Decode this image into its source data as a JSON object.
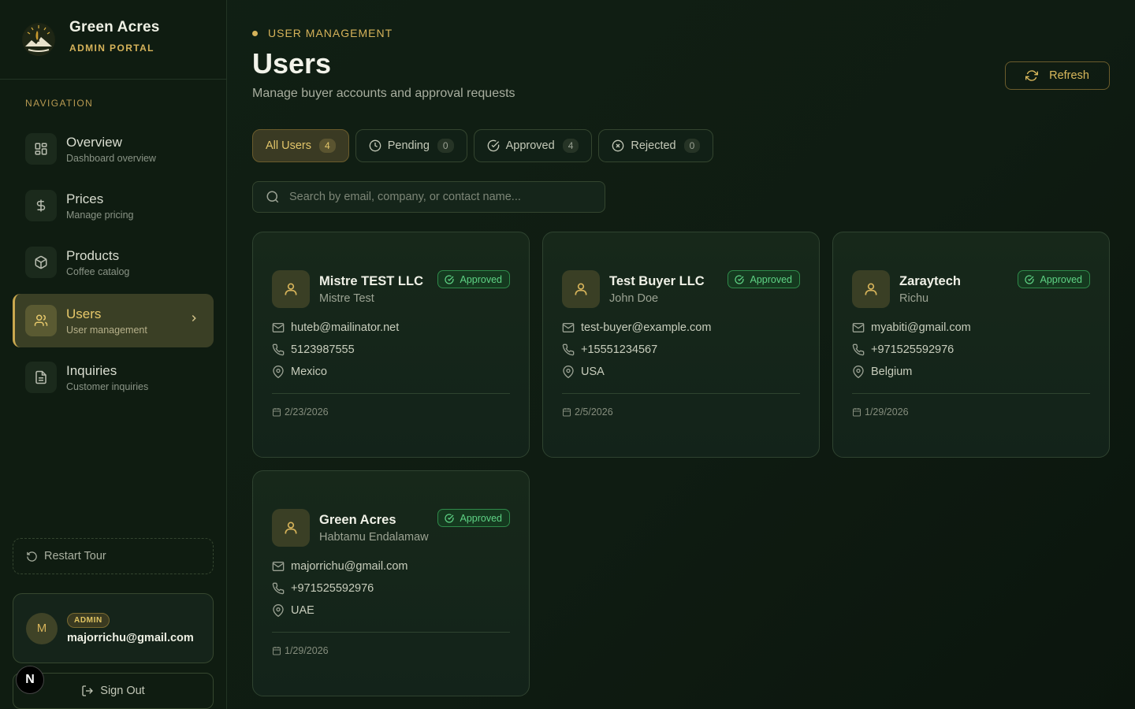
{
  "brand": {
    "title": "Green Acres",
    "subtitle": "ADMIN PORTAL"
  },
  "sidebar": {
    "heading": "NAVIGATION",
    "items": [
      {
        "label": "Overview",
        "desc": "Dashboard overview",
        "icon": "grid-icon"
      },
      {
        "label": "Prices",
        "desc": "Manage pricing",
        "icon": "dollar-icon"
      },
      {
        "label": "Products",
        "desc": "Coffee catalog",
        "icon": "box-icon"
      },
      {
        "label": "Users",
        "desc": "User management",
        "icon": "users-icon",
        "active": true
      },
      {
        "label": "Inquiries",
        "desc": "Customer inquiries",
        "icon": "file-icon"
      }
    ],
    "restart_label": "Restart Tour",
    "user": {
      "initial": "M",
      "role": "ADMIN",
      "email": "majorrichu@gmail.com"
    },
    "signout_label": "Sign Out",
    "n_badge": "N"
  },
  "header": {
    "eyebrow": "USER MANAGEMENT",
    "title": "Users",
    "subtitle": "Manage buyer accounts and approval requests",
    "refresh_label": "Refresh"
  },
  "tabs": [
    {
      "label": "All Users",
      "count": "4",
      "active": true
    },
    {
      "label": "Pending",
      "count": "0",
      "icon": "clock-icon"
    },
    {
      "label": "Approved",
      "count": "4",
      "icon": "check-circle-icon"
    },
    {
      "label": "Rejected",
      "count": "0",
      "icon": "x-circle-icon"
    }
  ],
  "search": {
    "placeholder": "Search by email, company, or contact name...",
    "value": ""
  },
  "users": [
    {
      "company": "Mistre TEST LLC",
      "contact": "Mistre Test",
      "status": "Approved",
      "email": "huteb@mailinator.net",
      "phone": "5123987555",
      "location": "Mexico",
      "date": "2/23/2026"
    },
    {
      "company": "Test Buyer LLC",
      "contact": "John Doe",
      "status": "Approved",
      "email": "test-buyer@example.com",
      "phone": "+15551234567",
      "location": "USA",
      "date": "2/5/2026"
    },
    {
      "company": "Zaraytech",
      "contact": "Richu",
      "status": "Approved",
      "email": "myabiti@gmail.com",
      "phone": "+971525592976",
      "location": "Belgium",
      "date": "1/29/2026"
    },
    {
      "company": "Green Acres",
      "contact": "Habtamu Endalamaw",
      "status": "Approved",
      "email": "majorrichu@gmail.com",
      "phone": "+971525592976",
      "location": "UAE",
      "date": "1/29/2026"
    }
  ],
  "colors": {
    "accent": "#d6b35a",
    "approved": "#5fd385",
    "background": "#112014"
  }
}
